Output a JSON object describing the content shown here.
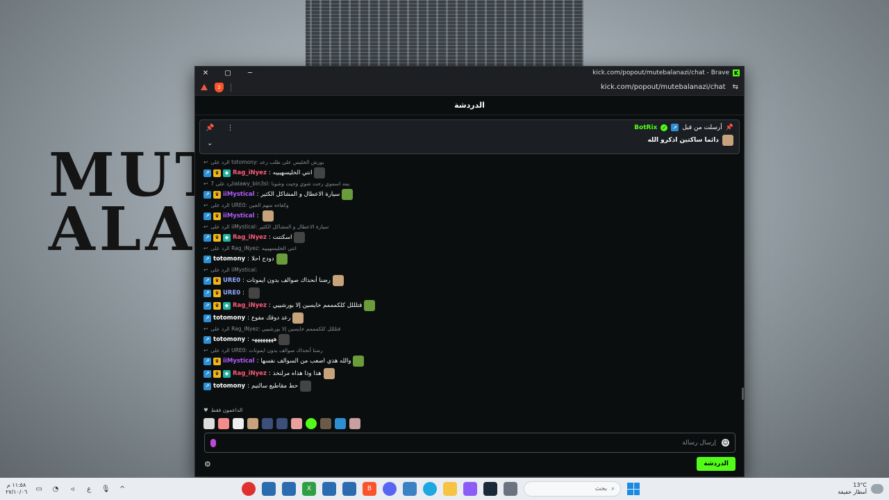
{
  "wallpaper": {
    "title_line1": "MUT",
    "title_line2": "ALAN"
  },
  "browser": {
    "window_title": "kick.com/popout/mutebalanazi/chat - Brave",
    "url": "kick.com/popout/mutebalanazi/chat",
    "shield_count": "2"
  },
  "chat": {
    "header": "الدردشة",
    "pinned": {
      "sent_by_label": "أرسلت من قبل",
      "user": "BotRix",
      "message": "دائما ساكتين اذكرو الله"
    },
    "messages": [
      {
        "reply": "الرد على totomony: بورش الخليس على طلب رعد",
        "user": "Rag_iNyez",
        "color": "#ff5a7a",
        "text": "انتي الخليسهيييه",
        "badges": 3
      },
      {
        "reply": "الرد على 7alawy_bin3sl: يمه اسموي رحت شوي وجيت وشونا",
        "user": "iiMystical",
        "color": "#b35cff",
        "text": "سيارة الاعطال و المشاكل الكثير",
        "badges": 2
      },
      {
        "reply": "الرد على URE0: وكفاءه منهم الجين",
        "user": "iiMystical",
        "color": "#b35cff",
        "text": "",
        "badges": 2
      },
      {
        "reply": "الرد على iiMystical: سيارة الاعطال و المشاكل الكثير",
        "user": "Rag_iNyez",
        "color": "#ff5a7a",
        "text": "اسكتتت",
        "badges": 3
      },
      {
        "reply": "الرد على Rag_iNyez: انتي الخليسهيييه",
        "user": "totomony",
        "color": "#ffffff",
        "text": "دودج احلا",
        "badges": 1
      },
      {
        "reply": "الرد على iiMystical:",
        "user": "URE0",
        "color": "#8fa9ff",
        "text": "رضنا أنحداك صوالف بدون ايموتات",
        "badges": 2
      },
      {
        "reply": "",
        "user": "URE0",
        "color": "#8fa9ff",
        "text": "",
        "badges": 2
      },
      {
        "reply": "",
        "user": "Rag_iNyez",
        "color": "#ff5a7a",
        "text": "قتلللل كلكمممم خايسين إلا بورشييي",
        "badges": 3
      },
      {
        "reply": "",
        "user": "totomony",
        "color": "#ffffff",
        "text": "رعد دوقك مفوع",
        "badges": 1
      },
      {
        "reply": "الرد على Rag_iNyez: قتلللل كلكمممم خايسين إلا بورشييي",
        "user": "totomony",
        "color": "#ffffff",
        "text": "ههههههههه",
        "badges": 1
      },
      {
        "reply": "الرد على URE0: رضنا أنحداك صوالف بدون ايموتات",
        "user": "iiMystical",
        "color": "#b35cff",
        "text": "والله هذي اصعب من السوالف نفسها",
        "badges": 2
      },
      {
        "reply": "",
        "user": "Rag_iNyez",
        "color": "#ff5a7a",
        "text": "هذا وذا هذاه مرلنخذ",
        "badges": 3
      },
      {
        "reply": "",
        "user": "totomony",
        "color": "#ffffff",
        "text": "حط مقاطيع سالتيم",
        "badges": 1
      }
    ],
    "supporters_label": "الداعمون فقط",
    "composer_placeholder": "إرسال رسالة",
    "send_button": "الدردشة"
  },
  "taskbar": {
    "time": "١١:٥٨ م",
    "date": "٢٧/١٠/٠٦",
    "lang": "ع",
    "search_placeholder": "بحث",
    "weather_temp": "13°C",
    "weather_desc": "أمطار خفيفة"
  },
  "colors": {
    "kick_green": "#53fc18",
    "brave_orange": "#fb542b"
  }
}
